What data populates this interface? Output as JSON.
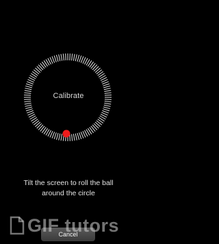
{
  "calibration": {
    "center_label": "Calibrate",
    "instruction": "Tilt the screen to roll the ball around the circle",
    "ball_color": "#ee1c1c",
    "tick_color": "#e6e6e6"
  },
  "actions": {
    "cancel_label": "Cancel"
  },
  "watermark": {
    "text": "GIF tutors",
    "icon": "document-icon"
  }
}
